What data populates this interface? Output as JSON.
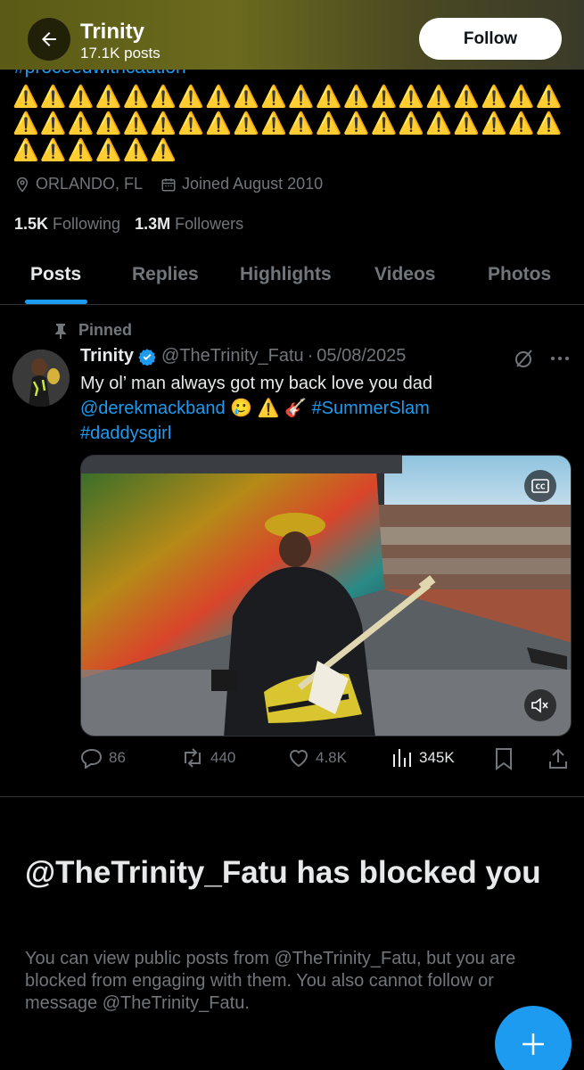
{
  "header": {
    "title": "Trinity",
    "posts_count": "17.1K posts",
    "follow_label": "Follow"
  },
  "bio": {
    "hashtag": "#proceedwithcaution",
    "warning_row_1": "⚠️⚠️⚠️⚠️⚠️⚠️⚠️⚠️⚠️⚠️⚠️⚠️⚠️⚠️⚠️⚠️⚠️⚠️⚠️⚠️",
    "warning_row_2": "⚠️⚠️⚠️⚠️⚠️⚠️⚠️⚠️⚠️⚠️⚠️⚠️⚠️⚠️⚠️⚠️⚠️⚠️⚠️⚠️",
    "warning_row_3": "⚠️⚠️⚠️⚠️⚠️⚠️",
    "location": "ORLANDO, FL",
    "joined": "Joined August 2010"
  },
  "stats": {
    "following_count": "1.5K",
    "following_label": "Following",
    "followers_count": "1.3M",
    "followers_label": "Followers"
  },
  "tabs": [
    {
      "label": "Posts",
      "active": true
    },
    {
      "label": "Replies"
    },
    {
      "label": "Highlights"
    },
    {
      "label": "Videos"
    },
    {
      "label": "Photos"
    }
  ],
  "post": {
    "pinned_label": "Pinned",
    "author_name": "Trinity",
    "handle": "@TheTrinity_Fatu",
    "date_sep": "·",
    "date": "05/08/2025",
    "text_part1": "My ol’ man always got my back love you dad",
    "mention": "@derekmackband",
    "emojis": "🥲 ⚠️ 🎸",
    "hashtag1": "#SummerSlam",
    "hashtag2": "#daddysgirl",
    "replies": "86",
    "reposts": "440",
    "likes": "4.8K",
    "views": "345K"
  },
  "blocked": {
    "title": "@TheTrinity_Fatu has blocked you",
    "text": "You can view public posts from @TheTrinity_Fatu, but you are blocked from engaging with them. You also cannot follow or message @TheTrinity_Fatu."
  },
  "colors": {
    "accent": "#1d9bf0",
    "muted": "#71767b",
    "text": "#e7e9ea",
    "background": "#000000"
  }
}
